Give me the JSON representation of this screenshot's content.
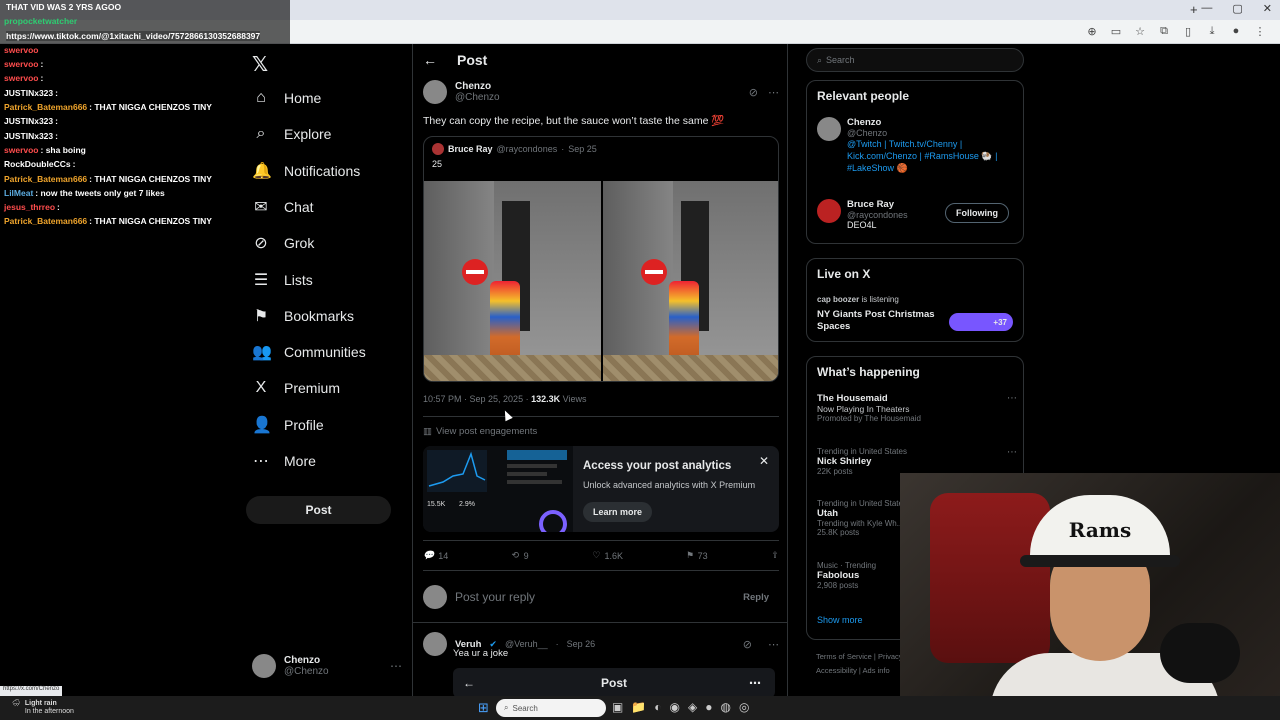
{
  "browser": {
    "new_tab": "+",
    "win_controls": [
      "—",
      "▢",
      "✕"
    ],
    "toolbar_icons": [
      "zoom-icon",
      "cast-icon",
      "star-icon",
      "extensions-icon",
      "sidebar-icon",
      "download-icon",
      "profile-icon",
      "menu-icon"
    ]
  },
  "chat": {
    "lines": [
      {
        "user": "",
        "text": "THAT VID WAS 2 YRS AGOO",
        "color": "#e0b64d"
      },
      {
        "user": "propocketwatcher",
        "text": "",
        "color": "#2ecc71"
      },
      {
        "user": "",
        "text": "https://www.tiktok.com/@1xitachi_video/7572866130352688397",
        "color": "#ffffff"
      },
      {
        "user": "swervoo",
        "text": "",
        "color": "#ff4d4d"
      },
      {
        "user": "swervoo",
        "text": ":",
        "color": "#ff4d4d"
      },
      {
        "user": "swervoo",
        "text": ":",
        "color": "#ff4d4d"
      },
      {
        "user": "JUSTINx323",
        "text": ":",
        "color": "#ffffff"
      },
      {
        "user": "Patrick_Bateman666",
        "text": ": THAT NIGGA CHENZOS TINY",
        "color": "#f0a52c"
      },
      {
        "user": "JUSTINx323",
        "text": ":",
        "color": "#ffffff"
      },
      {
        "user": "JUSTINx323",
        "text": ":",
        "color": "#ffffff"
      },
      {
        "user": "swervoo",
        "text": ": sha boing",
        "color": "#ff4d4d"
      },
      {
        "user": "RockDoubleCCs",
        "text": ":",
        "color": "#ffffff"
      },
      {
        "user": "Patrick_Bateman666",
        "text": ": THAT NIGGA CHENZOS TINY",
        "color": "#f0a52c"
      },
      {
        "user": "LilMeat",
        "text": ": now the tweets only get 7 likes",
        "color": "#5dade2"
      },
      {
        "user": "jesus_thrreo",
        "text": ":",
        "color": "#ff4d4d"
      },
      {
        "user": "Patrick_Bateman666",
        "text": ": THAT NIGGA CHENZOS TINY",
        "color": "#f0a52c"
      }
    ]
  },
  "sidebar": {
    "items": [
      {
        "label": "Home",
        "icon": "⌂",
        "name": "home"
      },
      {
        "label": "Explore",
        "icon": "⌕",
        "name": "explore"
      },
      {
        "label": "Notifications",
        "icon": "🔔",
        "name": "notifications"
      },
      {
        "label": "Chat",
        "icon": "✉",
        "name": "chat"
      },
      {
        "label": "Grok",
        "icon": "⊘",
        "name": "grok"
      },
      {
        "label": "Lists",
        "icon": "☰",
        "name": "lists"
      },
      {
        "label": "Bookmarks",
        "icon": "⚑",
        "name": "bookmarks"
      },
      {
        "label": "Communities",
        "icon": "👥",
        "name": "communities"
      },
      {
        "label": "Premium",
        "icon": "X",
        "name": "premium"
      },
      {
        "label": "Profile",
        "icon": "👤",
        "name": "profile"
      },
      {
        "label": "More",
        "icon": "⋯",
        "name": "more"
      }
    ],
    "post_label": "Post",
    "account": {
      "name": "Chenzo",
      "handle": "@Chenzo"
    }
  },
  "main": {
    "header_title": "Post",
    "tweet": {
      "author": "Chenzo",
      "handle": "@Chenzo",
      "text": "They can copy the recipe, but the sauce won’t taste the same 💯",
      "quote": {
        "author": "Bruce Ray",
        "handle": "@raycondones",
        "date": "Sep 25",
        "text": "25"
      },
      "time": "10:57 PM · Sep 25, 2025",
      "views": "132.3K",
      "views_label": "Views",
      "engagements": "View post engagements",
      "analytics": {
        "title": "Access your post analytics",
        "subtitle": "Unlock advanced analytics with X Premium",
        "button": "Learn more",
        "stat1": "15.5K",
        "stat2": "2.9%"
      },
      "actions": {
        "replies": "14",
        "reposts": "9",
        "likes": "1.6K",
        "bookmarks": "73"
      }
    },
    "reply_placeholder": "Post your reply",
    "reply_button": "Reply",
    "reply2": {
      "author": "Veruh",
      "handle": "@Veruh__",
      "date": "Sep 26",
      "text": "Yea ur a joke",
      "embed_title": "Post"
    }
  },
  "right": {
    "search_placeholder": "Search",
    "relevant_title": "Relevant people",
    "people": [
      {
        "name": "Chenzo",
        "handle": "@Chenzo",
        "bio1": "@Twitch | Twitch.tv/Chenny |",
        "bio2": "Kick.com/Chenzo | #RamsHouse 🐏 |",
        "bio3": "#LakeShow 🏀"
      },
      {
        "name": "Bruce Ray",
        "handle": "@raycondones",
        "bio1": "DEO4L",
        "follow": "Following"
      }
    ],
    "live_title": "Live on X",
    "live": {
      "host": "cap boozer",
      "status": "is listening",
      "title1": "NY Giants Post Christmas",
      "title2": "Spaces",
      "count": "+37"
    },
    "happening_title": "What’s happening",
    "trends": [
      {
        "meta": "",
        "title": "The Housemaid",
        "sub": "Now Playing In Theaters",
        "sub2": "Promoted by The Housemaid"
      },
      {
        "meta": "Trending in United States",
        "title": "Nick Shirley",
        "sub": "22K posts"
      },
      {
        "meta": "Trending in United States",
        "title": "Utah",
        "sub": "Trending with Kyle Wh...",
        "sub2": "25.8K posts"
      },
      {
        "meta": "Music · Trending",
        "title": "Fabolous",
        "sub": "2,908 posts"
      }
    ],
    "show_more": "Show more",
    "footer1": "Terms of Service  |  Privacy",
    "footer2": "Accessibility  |  Ads info"
  },
  "webcam": {
    "hat_text": "Rams"
  },
  "taskbar": {
    "weather_title": "Light rain",
    "weather_sub": "In the afternoon",
    "search_placeholder": "Search",
    "status_url": "https://x.com/Chenzo"
  }
}
